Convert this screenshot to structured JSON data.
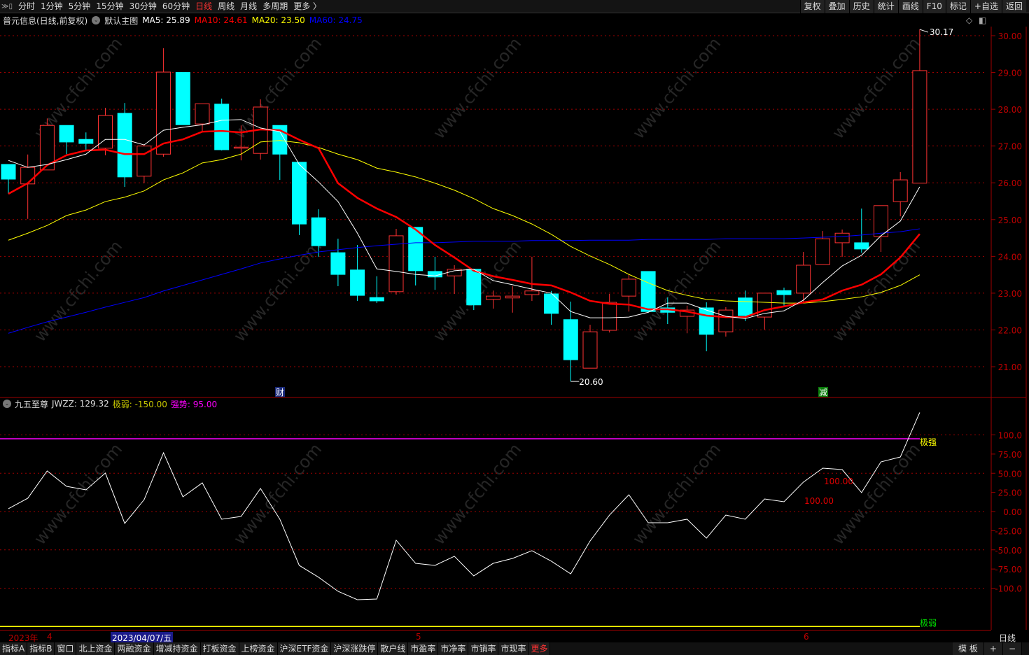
{
  "topbar": {
    "periods": [
      "分时",
      "1分钟",
      "5分钟",
      "15分钟",
      "30分钟",
      "60分钟",
      "日线",
      "周线",
      "月线",
      "多周期",
      "更多 〉"
    ],
    "active": "日线",
    "right": [
      "复权",
      "叠加",
      "历史",
      "统计",
      "画线",
      "F10",
      "标记",
      "+自选",
      "返回"
    ]
  },
  "legend": {
    "title": "普元信息(日线,前复权)",
    "template": "默认主图",
    "ma5": "MA5: 25.89",
    "ma10": "MA10: 24.61",
    "ma20": "MA20: 23.50",
    "ma60": "MA60: 24.75"
  },
  "indicator": {
    "name": "九五至尊",
    "jwzz": "JWZZ: 129.32",
    "weak": "极弱: -150.00",
    "strong": "强势: 95.00",
    "label_strong": "极强",
    "label_weak": "极弱",
    "note1": "100.00",
    "note2": "100.00",
    "strong_level": 95,
    "weak_level": -150,
    "last": 129.32
  },
  "markers": {
    "cai": "财",
    "jian": "减"
  },
  "price_axis": [
    "30.00",
    "29.00",
    "28.00",
    "27.00",
    "26.00",
    "25.00",
    "24.00",
    "23.00",
    "22.00",
    "21.00"
  ],
  "ind_axis": [
    "100.0",
    "75.00",
    "50.00",
    "25.00",
    "0.00",
    "-25.00",
    "-50.00",
    "-75.00",
    "-100.0"
  ],
  "annotations": {
    "high": "30.17",
    "low": "20.60"
  },
  "time_axis": {
    "year": "2023年",
    "m4": "4",
    "cursor": "2023/04/07/五",
    "m5": "5",
    "m6": "6"
  },
  "period_label": "日线",
  "bottombar": {
    "tabs": [
      "指标A",
      "指标B",
      "窗口",
      "北上资金",
      "两融资金",
      "增减持资金",
      "打板资金",
      "上榜资金",
      "沪深ETF资金",
      "沪深涨跌停",
      "散户线",
      "市盈率",
      "市净率",
      "市销率",
      "市现率",
      "更多"
    ],
    "right": [
      "模 板",
      "+",
      "−"
    ]
  },
  "watermark": "www.cfchi.com",
  "colors": {
    "up": "#ff3232",
    "down": "#00ffff",
    "ma5": "#ffffff",
    "ma10": "#ff0000",
    "ma20": "#ffff00",
    "ma60": "#0000ff",
    "grid": "#a00000",
    "strong": "#ff00ff",
    "weak": "#ffff00"
  },
  "chart_data": {
    "type": "candlestick",
    "ylim": [
      20.5,
      30.3
    ],
    "candles": [
      [
        26.5,
        26.1,
        26.5,
        25.7
      ],
      [
        25.97,
        26.42,
        26.77,
        25.02
      ],
      [
        26.35,
        27.56,
        27.75,
        26.35
      ],
      [
        27.56,
        27.11,
        27.56,
        26.78
      ],
      [
        27.18,
        27.07,
        27.37,
        26.9
      ],
      [
        26.94,
        27.83,
        28.04,
        26.75
      ],
      [
        27.89,
        26.16,
        28.17,
        25.89
      ],
      [
        26.18,
        27.0,
        27.03,
        25.99
      ],
      [
        26.78,
        29.01,
        29.66,
        26.71
      ],
      [
        29.0,
        27.58,
        29.0,
        27.58
      ],
      [
        27.6,
        28.15,
        28.15,
        27.39
      ],
      [
        28.14,
        26.9,
        28.29,
        26.88
      ],
      [
        26.95,
        26.97,
        27.56,
        26.61
      ],
      [
        26.8,
        28.06,
        28.27,
        26.63
      ],
      [
        27.56,
        26.78,
        27.56,
        26.08
      ],
      [
        26.56,
        24.88,
        26.56,
        24.58
      ],
      [
        25.05,
        24.29,
        25.28,
        23.99
      ],
      [
        24.1,
        23.51,
        24.48,
        23.19
      ],
      [
        23.63,
        22.94,
        24.31,
        22.79
      ],
      [
        22.88,
        22.79,
        23.46,
        22.73
      ],
      [
        23.04,
        24.56,
        24.75,
        22.96
      ],
      [
        24.79,
        23.61,
        24.79,
        23.21
      ],
      [
        23.59,
        23.44,
        23.99,
        23.09
      ],
      [
        23.47,
        23.65,
        23.76,
        22.98
      ],
      [
        23.65,
        22.68,
        23.65,
        22.54
      ],
      [
        22.83,
        22.92,
        23.07,
        22.58
      ],
      [
        22.87,
        22.92,
        23.19,
        22.47
      ],
      [
        22.96,
        23.06,
        23.99,
        22.79
      ],
      [
        22.98,
        22.45,
        23.06,
        22.14
      ],
      [
        22.28,
        21.19,
        22.77,
        20.6
      ],
      [
        20.96,
        21.95,
        22.14,
        20.96
      ],
      [
        21.99,
        22.75,
        22.98,
        21.93
      ],
      [
        22.92,
        23.38,
        23.51,
        22.5
      ],
      [
        23.59,
        22.5,
        23.59,
        22.47
      ],
      [
        22.6,
        22.48,
        22.88,
        22.16
      ],
      [
        22.37,
        22.54,
        22.66,
        21.91
      ],
      [
        22.6,
        21.88,
        22.75,
        21.42
      ],
      [
        21.95,
        22.54,
        22.62,
        21.82
      ],
      [
        22.87,
        22.39,
        23.07,
        22.24
      ],
      [
        22.35,
        23.0,
        23.0,
        22.01
      ],
      [
        23.07,
        22.96,
        23.15,
        22.66
      ],
      [
        23.0,
        23.76,
        24.12,
        22.75
      ],
      [
        23.78,
        24.48,
        24.69,
        23.78
      ],
      [
        24.37,
        24.63,
        24.73,
        23.99
      ],
      [
        24.37,
        24.2,
        25.3,
        24.1
      ],
      [
        24.54,
        25.38,
        25.38,
        24.12
      ],
      [
        25.49,
        26.08,
        26.29,
        25.09
      ],
      [
        25.99,
        29.05,
        30.17,
        25.99
      ]
    ],
    "candle_fields": [
      "open",
      "close",
      "high",
      "low"
    ],
    "ma5": [
      26.61,
      26.42,
      26.5,
      26.63,
      26.78,
      27.18,
      27.18,
      27.03,
      27.43,
      27.51,
      27.58,
      27.7,
      27.72,
      27.49,
      27.39,
      26.5,
      26.02,
      25.49,
      24.63,
      23.66,
      23.59,
      23.51,
      23.47,
      23.61,
      23.65,
      23.34,
      23.23,
      23.11,
      23.0,
      22.5,
      22.33,
      22.33,
      22.35,
      22.48,
      22.73,
      22.73,
      22.54,
      22.37,
      22.31,
      22.45,
      22.52,
      22.81,
      23.29,
      23.74,
      24.03,
      24.56,
      24.96,
      25.89
    ],
    "ma10": [
      25.7,
      25.99,
      26.48,
      26.75,
      26.88,
      26.9,
      26.78,
      26.78,
      27.07,
      27.18,
      27.39,
      27.41,
      27.37,
      27.45,
      27.43,
      27.17,
      26.94,
      25.99,
      25.59,
      25.3,
      25.07,
      24.73,
      24.31,
      23.97,
      23.61,
      23.46,
      23.36,
      23.25,
      23.21,
      23.02,
      22.79,
      22.71,
      22.69,
      22.56,
      22.56,
      22.5,
      22.39,
      22.35,
      22.35,
      22.54,
      22.64,
      22.75,
      22.83,
      23.07,
      23.23,
      23.51,
      23.97,
      24.61
    ],
    "ma20": [
      24.44,
      24.63,
      24.84,
      25.11,
      25.26,
      25.49,
      25.61,
      25.78,
      26.08,
      26.27,
      26.54,
      26.63,
      26.78,
      27.11,
      27.15,
      27.09,
      26.96,
      26.78,
      26.63,
      26.4,
      26.29,
      26.16,
      25.99,
      25.8,
      25.57,
      25.3,
      25.11,
      24.88,
      24.6,
      24.27,
      24.01,
      23.78,
      23.51,
      23.28,
      23.07,
      22.94,
      22.83,
      22.79,
      22.77,
      22.75,
      22.73,
      22.73,
      22.77,
      22.83,
      22.9,
      23.02,
      23.21,
      23.5
    ],
    "ma60": [
      21.91,
      22.07,
      22.22,
      22.35,
      22.48,
      22.62,
      22.75,
      22.88,
      23.06,
      23.21,
      23.36,
      23.51,
      23.66,
      23.82,
      23.93,
      24.03,
      24.12,
      24.18,
      24.24,
      24.29,
      24.33,
      24.37,
      24.37,
      24.39,
      24.41,
      24.41,
      24.41,
      24.43,
      24.43,
      24.43,
      24.44,
      24.44,
      24.44,
      24.46,
      24.46,
      24.46,
      24.46,
      24.48,
      24.48,
      24.48,
      24.48,
      24.5,
      24.52,
      24.54,
      24.58,
      24.63,
      24.67,
      24.75
    ],
    "jwzz": [
      3.7,
      17.4,
      53.0,
      32.9,
      28.3,
      50.2,
      -15.5,
      15.5,
      76.7,
      19.2,
      37.4,
      -10.0,
      -6.4,
      30.1,
      -10.0,
      -70.3,
      -85.8,
      -104.1,
      -115.1,
      -114.2,
      -37.4,
      -67.6,
      -70.3,
      -58.4,
      -84.0,
      -67.6,
      -61.2,
      -51.1,
      -64.8,
      -81.3,
      -38.4,
      -4.6,
      21.9,
      -14.6,
      -14.6,
      -10.0,
      -34.7,
      -4.6,
      -10.0,
      16.4,
      12.8,
      38.4,
      56.6,
      54.8,
      24.7,
      64.8,
      71.2,
      129.32
    ],
    "ind_ylim": [
      -170,
      140
    ]
  }
}
